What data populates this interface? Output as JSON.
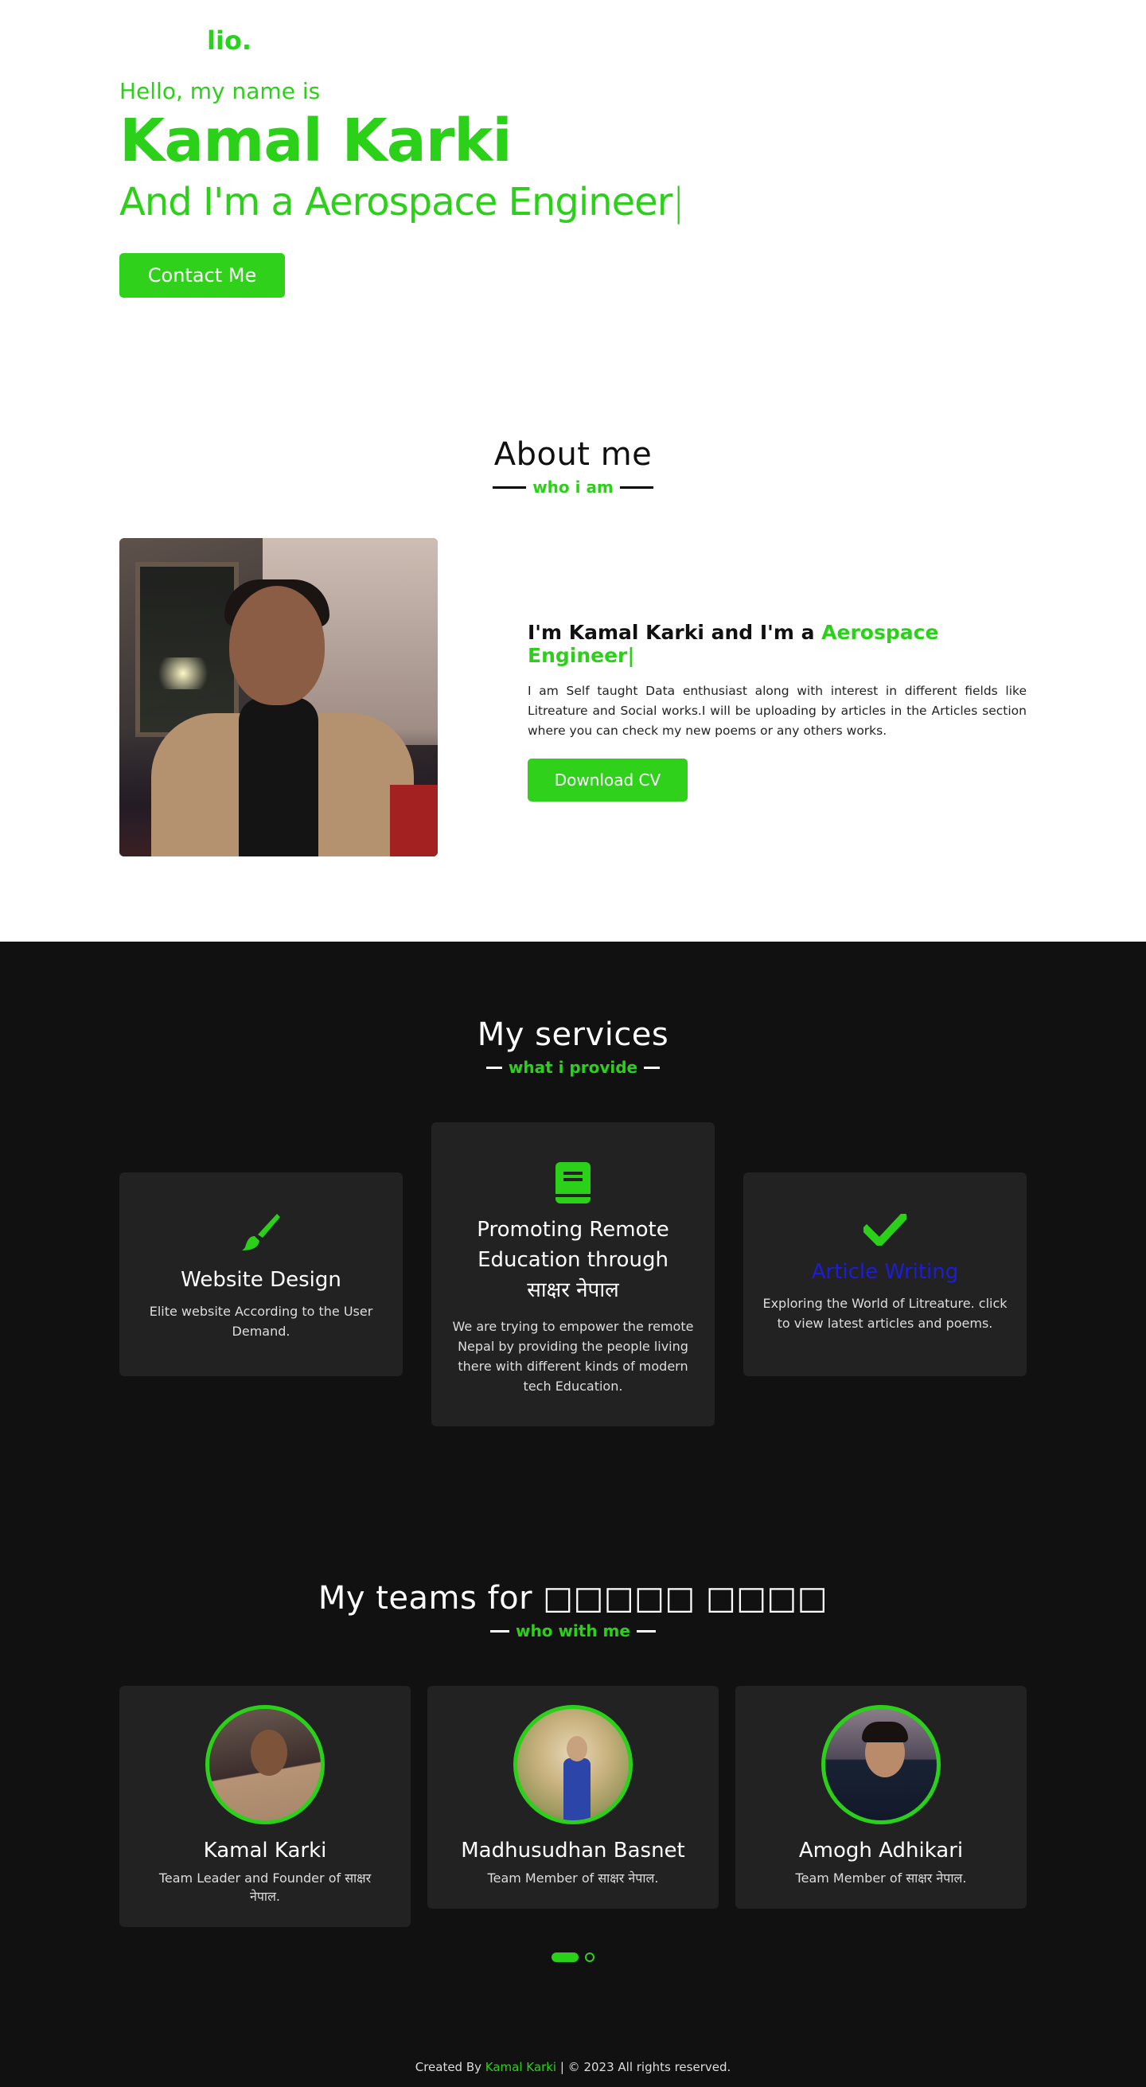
{
  "brand": {
    "logo": "lio."
  },
  "hero": {
    "greeting": "Hello, my name is",
    "name": "Kamal Karki",
    "role_prefix": "And I'm a ",
    "role_highlight": "Aerospace Engineer",
    "cursor": "|",
    "contact_label": "Contact Me"
  },
  "about": {
    "title": "About me",
    "subtitle": "who i am",
    "heading_prefix": "I'm Kamal Karki and I'm a ",
    "heading_highlight": "Aerospace Engineer",
    "heading_cursor": "|",
    "paragraph": "I am Self taught Data enthusiast along with interest in different fields like Litreature and Social works.I will be uploading by articles in the Articles section where you can check my new poems or any others works.",
    "download_label": "Download CV"
  },
  "services": {
    "title": "My services",
    "subtitle": "what i provide",
    "items": [
      {
        "icon": "paint-brush-icon",
        "title": "Website Design",
        "text": "Elite website According to the User Demand."
      },
      {
        "icon": "book-icon",
        "title": "Promoting Remote Education through साक्षर नेपाल",
        "text": "We are trying to empower the remote Nepal by providing the people living there with different kinds of modern tech Education."
      },
      {
        "icon": "check-icon",
        "title": "Article Writing",
        "text": "Exploring the World of Litreature. click to view latest articles and poems."
      }
    ]
  },
  "teams": {
    "title": "My teams for □□□□□ □□□□",
    "subtitle": "who with me",
    "members": [
      {
        "name": "Kamal Karki",
        "role": "Team Leader and Founder of साक्षर नेपाल."
      },
      {
        "name": "Madhusudhan Basnet",
        "role": "Team Member of साक्षर नेपाल."
      },
      {
        "name": "Amogh Adhikari",
        "role": "Team Member of साक्षर नेपाल."
      }
    ]
  },
  "footer": {
    "prefix": "Created By ",
    "author": "Kamal Karki",
    "suffix": " | © 2023 All rights reserved."
  },
  "colors": {
    "accent": "#2bd119",
    "dark_bg": "#111111",
    "card_bg": "#222222",
    "article_link": "#1d1dd6"
  }
}
